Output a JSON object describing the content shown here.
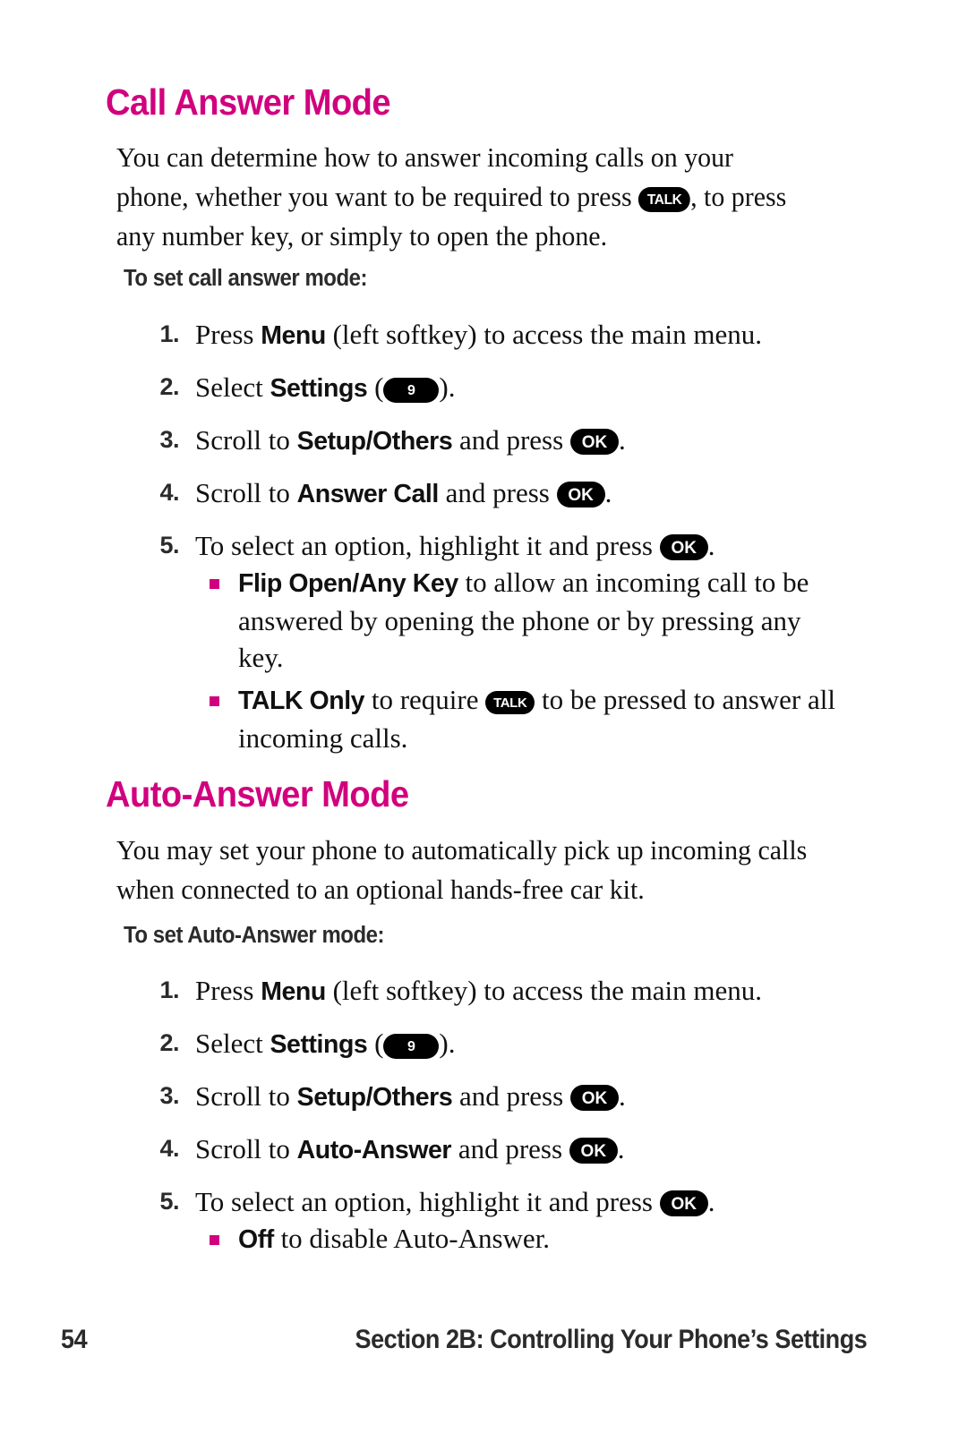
{
  "page": {
    "number": "54",
    "footer_section": "Section 2B: Controlling Your Phone’s Settings",
    "accent_color": "#D1007E"
  },
  "keys": {
    "talk": "TALK",
    "ok": "OK",
    "nine": "9"
  },
  "sections": [
    {
      "id": "call-answer-mode",
      "heading": "Call Answer Mode",
      "intro_parts": {
        "a": "You can determine how to answer incoming calls on your phone, whether you want to be required to press ",
        "b": ", to press any number key, or simply to open the phone."
      },
      "subheading": "To set call answer mode:",
      "steps": [
        {
          "num": "1.",
          "pre": "Press ",
          "bold": "Menu",
          "post": " (left softkey) to access the main menu."
        },
        {
          "num": "2.",
          "pre": "Select ",
          "bold": "Settings",
          "mid": " (",
          "key": "nine",
          "post": ")."
        },
        {
          "num": "3.",
          "pre": "Scroll to ",
          "bold": "Setup/Others",
          "mid": " and press ",
          "key": "ok",
          "post": "."
        },
        {
          "num": "4.",
          "pre": "Scroll to ",
          "bold": "Answer Call",
          "mid": " and press ",
          "key": "ok",
          "post": "."
        },
        {
          "num": "5.",
          "pre": "To select an option, highlight it and press ",
          "key": "ok",
          "post": "."
        }
      ],
      "bullets": [
        {
          "bold": "Flip Open/Any Key",
          "text_a": " to allow an incoming call to be answered by opening the phone or by pressing any key."
        },
        {
          "bold": "TALK Only",
          "text_a": " to require ",
          "key": "talk",
          "text_b": " to be pressed to answer all incoming calls."
        }
      ]
    },
    {
      "id": "auto-answer-mode",
      "heading": "Auto-Answer Mode",
      "intro_parts": {
        "a": "You may set your phone to automatically pick up incoming calls when connected to an optional hands-free car kit.",
        "b": ""
      },
      "subheading": "To set Auto-Answer mode:",
      "steps": [
        {
          "num": "1.",
          "pre": "Press ",
          "bold": "Menu",
          "post": " (left softkey) to access the main menu."
        },
        {
          "num": "2.",
          "pre": "Select ",
          "bold": "Settings",
          "mid": " (",
          "key": "nine",
          "post": ")."
        },
        {
          "num": "3.",
          "pre": "Scroll to ",
          "bold": "Setup/Others",
          "mid": " and press ",
          "key": "ok",
          "post": "."
        },
        {
          "num": "4.",
          "pre": "Scroll to ",
          "bold": "Auto-Answer",
          "mid": " and press ",
          "key": "ok",
          "post": "."
        },
        {
          "num": "5.",
          "pre": "To select an option, highlight it and press ",
          "key": "ok",
          "post": "."
        }
      ],
      "bullets": [
        {
          "bold": "Off",
          "text_a": " to disable Auto-Answer."
        }
      ]
    }
  ]
}
